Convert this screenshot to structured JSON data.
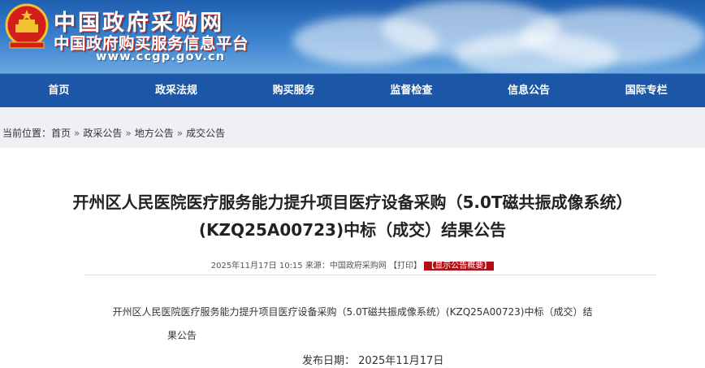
{
  "header": {
    "site_name": "中国政府采购网",
    "site_sub": "中国政府购买服务信息平台",
    "url": "www.ccgp.gov.cn"
  },
  "nav": {
    "items": [
      {
        "label": "首页"
      },
      {
        "label": "政采法规"
      },
      {
        "label": "购买服务"
      },
      {
        "label": "监督检查"
      },
      {
        "label": "信息公告"
      },
      {
        "label": "国际专栏"
      }
    ]
  },
  "breadcrumb": {
    "prefix": "当前位置：",
    "items": [
      "首页",
      "政采公告",
      "地方公告",
      "成交公告"
    ],
    "separator": "»"
  },
  "article": {
    "title_line1": "开州区人民医院医疗服务能力提升项目医疗设备采购（5.0T磁共振成像系统）",
    "title_line2": "(KZQ25A00723)中标（成交）结果公告",
    "meta_date": "2025年11月17日 10:15",
    "meta_source_label": "来源：",
    "meta_source": "中国政府采购网",
    "meta_print": "【打印】",
    "meta_tag": "【显示公告概要】",
    "body_line1": "开州区人民医院医疗服务能力提升项目医疗设备采购（5.0T磁共振成像系统）(KZQ25A00723)中标（成交）结",
    "body_line2": "果公告",
    "publish_label": "发布日期：",
    "publish_date": "2025年11月17日"
  },
  "colors": {
    "nav_bg": "#1b57a6",
    "banner_top": "#1f5fb0",
    "tag_bg": "#b10e16"
  }
}
